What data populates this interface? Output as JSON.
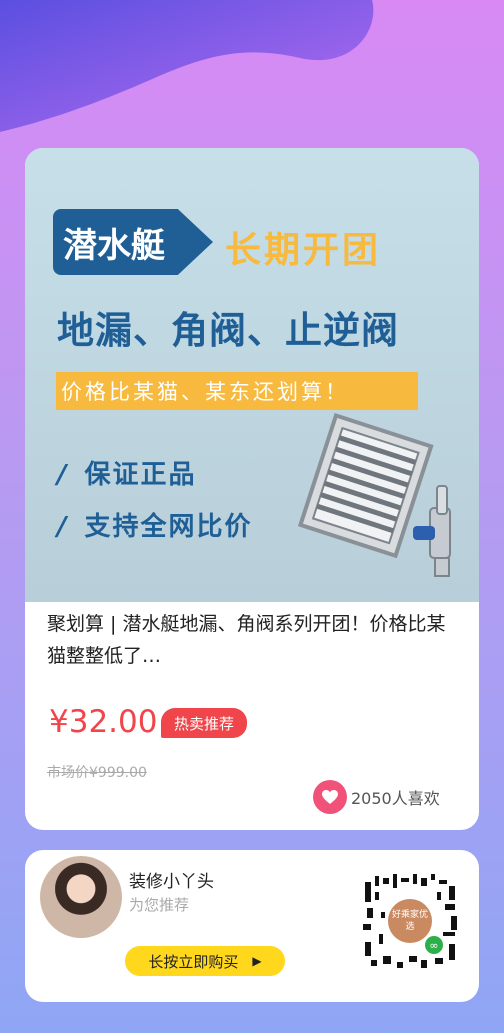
{
  "banner": {
    "brand": "潜水艇",
    "campaign": "长期开团",
    "products": "地漏、角阀、止逆阀",
    "strip": "价格比某猫、某东还划算！",
    "bullets": [
      "保证正品",
      "支持全网比价"
    ],
    "bullet_mark": "/"
  },
  "product": {
    "title": "聚划算 | 潜水艇地漏、角阀系列开团！价格比某猫整整低了…",
    "price": "¥32.00",
    "badge": "热卖推荐",
    "market_price": "市场价¥999.00",
    "likes": "2050人喜欢"
  },
  "share": {
    "name": "装修小丫头",
    "subtitle": "为您推荐",
    "button": "长按立即购买",
    "qr_center": "好乘家优选"
  },
  "colors": {
    "price_red": "#f0454a",
    "brand_blue": "#1f5f96",
    "accent_orange": "#f7b93e",
    "button_yellow": "#ffd81e"
  },
  "icons": {
    "heart": "heart-icon",
    "play": "play-triangle-icon",
    "miniprogram": "miniprogram-icon"
  }
}
